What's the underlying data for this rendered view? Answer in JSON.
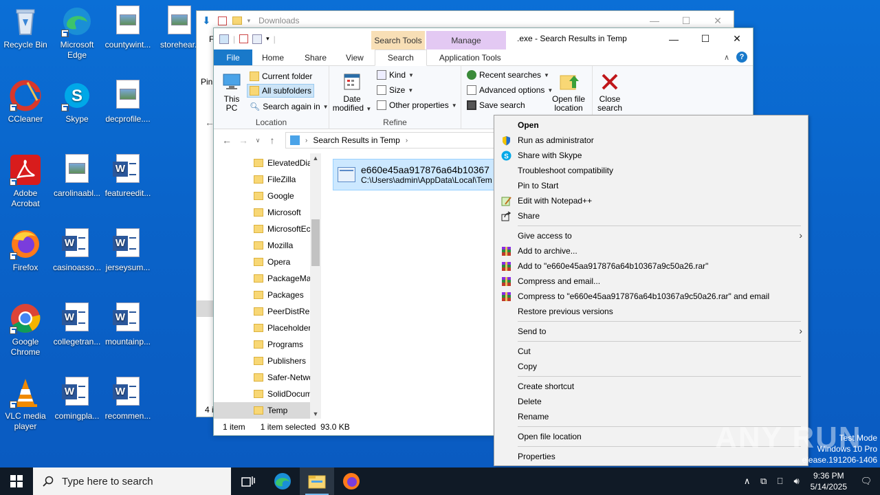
{
  "desktop": {
    "icons": [
      {
        "label": "Recycle Bin"
      },
      {
        "label": "Microsoft Edge"
      },
      {
        "label": "countywint..."
      },
      {
        "label": "storehear.j"
      },
      {
        "label": "CCleaner"
      },
      {
        "label": "Skype"
      },
      {
        "label": "decprofile...."
      },
      {
        "label": "Adobe Acrobat"
      },
      {
        "label": "carolinaabl..."
      },
      {
        "label": "featureedit..."
      },
      {
        "label": "Firefox"
      },
      {
        "label": "casinoasso..."
      },
      {
        "label": "jerseysum..."
      },
      {
        "label": "Google Chrome"
      },
      {
        "label": "collegetran..."
      },
      {
        "label": "mountainp..."
      },
      {
        "label": "VLC media player"
      },
      {
        "label": "comingpla..."
      },
      {
        "label": "recommen..."
      }
    ]
  },
  "back_window": {
    "title": "Downloads",
    "left_partial_1": "Pin",
    "left_partial_2": "F",
    "status_partial": "4 i"
  },
  "front_window": {
    "title": ".exe - Search Results in Temp",
    "context_tabs": {
      "search_tools": "Search Tools",
      "manage": "Manage"
    },
    "tabs": {
      "file": "File",
      "home": "Home",
      "share": "Share",
      "view": "View",
      "search": "Search",
      "application_tools": "Application Tools"
    },
    "ribbon": {
      "this_pc": "This PC",
      "current_folder": "Current folder",
      "all_subfolders": "All subfolders",
      "search_again_in": "Search again in",
      "location_group": "Location",
      "date_modified": "Date modified",
      "kind": "Kind",
      "size": "Size",
      "other_properties": "Other properties",
      "refine_group": "Refine",
      "recent_searches": "Recent searches",
      "advanced_options": "Advanced options",
      "save_search": "Save search",
      "open_file_location": "Open file location",
      "close_search": "Close search"
    },
    "address": {
      "crumb": "Search Results in Temp"
    },
    "nav_items": [
      "ElevatedDia",
      "FileZilla",
      "Google",
      "Microsoft",
      "MicrosoftEc",
      "Mozilla",
      "Opera",
      "PackageMa",
      "Packages",
      "PeerDistRep",
      "Placeholder",
      "Programs",
      "Publishers",
      "Safer-Netwo",
      "SolidDocum",
      "Temp"
    ],
    "result": {
      "name": "e660e45aa917876a64b10367",
      "path": "C:\\Users\\admin\\AppData\\Local\\Tem"
    },
    "status": {
      "count": "1 item",
      "selected": "1 item selected",
      "size": "93.0 KB"
    }
  },
  "context_menu": {
    "open": "Open",
    "run_as_admin": "Run as administrator",
    "share_skype": "Share with Skype",
    "troubleshoot": "Troubleshoot compatibility",
    "pin_start": "Pin to Start",
    "edit_notepad": "Edit with Notepad++",
    "share": "Share",
    "give_access": "Give access to",
    "add_archive": "Add to archive...",
    "add_to_rar": "Add to \"e660e45aa917876a64b10367a9c50a26.rar\"",
    "compress_email": "Compress and email...",
    "compress_to_rar_email": "Compress to \"e660e45aa917876a64b10367a9c50a26.rar\" and email",
    "restore_versions": "Restore previous versions",
    "send_to": "Send to",
    "cut": "Cut",
    "copy": "Copy",
    "create_shortcut": "Create shortcut",
    "delete": "Delete",
    "rename": "Rename",
    "open_file_location": "Open file location",
    "properties": "Properties"
  },
  "watermark": {
    "text": "ANY RUN"
  },
  "test_mode": {
    "line1": "Test Mode",
    "line2": "Windows 10 Pro",
    "line3": "elease.191206-1406"
  },
  "taskbar": {
    "search_placeholder": "Type here to search",
    "time": "9:36 PM",
    "date": "5/14/2025"
  },
  "colors": {
    "desktop": "#0a63c9",
    "accent": "#1979ca",
    "selection": "#cce8ff",
    "taskbar": "#101a26"
  }
}
